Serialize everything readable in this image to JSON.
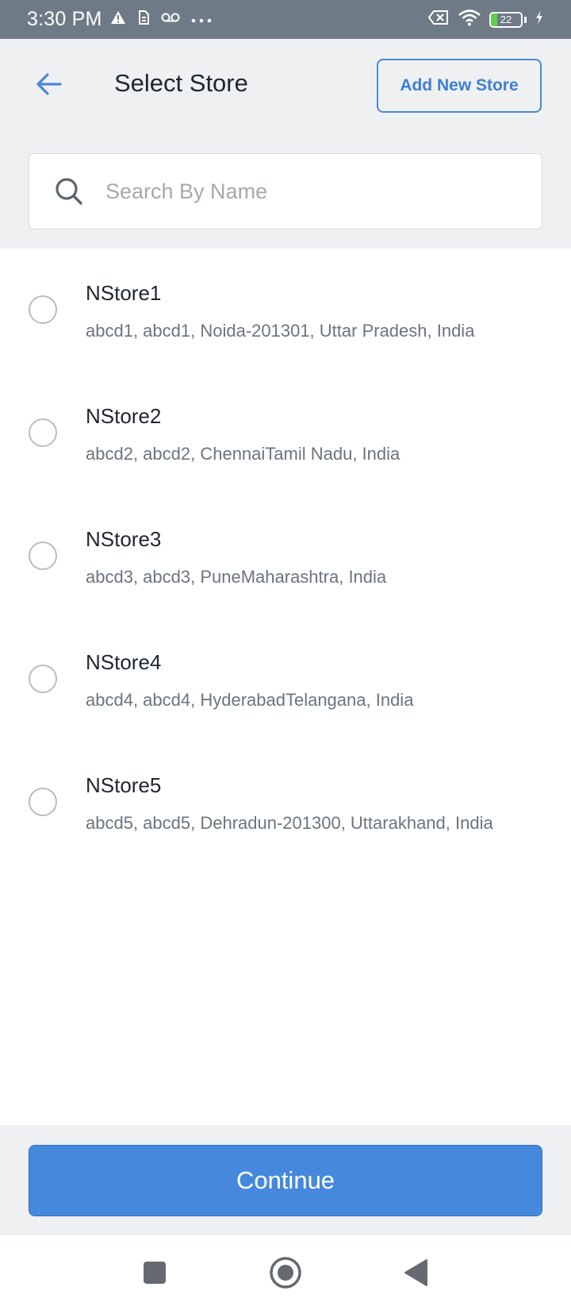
{
  "status_bar": {
    "time": "3:30 PM",
    "icons_left": [
      "warning-icon",
      "sim-icon",
      "voicemail-icon",
      "more-dots-icon"
    ],
    "icons_right": [
      "no-sim-icon",
      "wifi-icon",
      "battery-icon",
      "charging-icon"
    ],
    "battery_level": "22"
  },
  "header": {
    "back_icon": "arrow-left-icon",
    "title": "Select Store",
    "add_button_label": "Add New Store"
  },
  "search": {
    "icon": "search-icon",
    "placeholder": "Search By Name",
    "value": ""
  },
  "stores": [
    {
      "name": "NStore1",
      "address": "abcd1, abcd1, Noida-201301, Uttar Pradesh, India",
      "selected": false
    },
    {
      "name": "NStore2",
      "address": "abcd2, abcd2, ChennaiTamil Nadu, India",
      "selected": false
    },
    {
      "name": "NStore3",
      "address": "abcd3, abcd3, PuneMaharashtra, India",
      "selected": false
    },
    {
      "name": "NStore4",
      "address": "abcd4, abcd4, HyderabadTelangana, India",
      "selected": false
    },
    {
      "name": "NStore5",
      "address": "abcd5, abcd5, Dehradun-201300, Uttarakhand, India",
      "selected": false
    }
  ],
  "footer": {
    "continue_label": "Continue"
  },
  "nav_bar": {
    "icons": [
      "recents-square-icon",
      "home-circle-icon",
      "back-triangle-icon"
    ]
  },
  "colors": {
    "status_bar_bg": "#6e7a86",
    "header_bg": "#eff0f2",
    "accent": "#4689dc",
    "text_primary": "#1f2530",
    "text_secondary": "#6b7480"
  }
}
